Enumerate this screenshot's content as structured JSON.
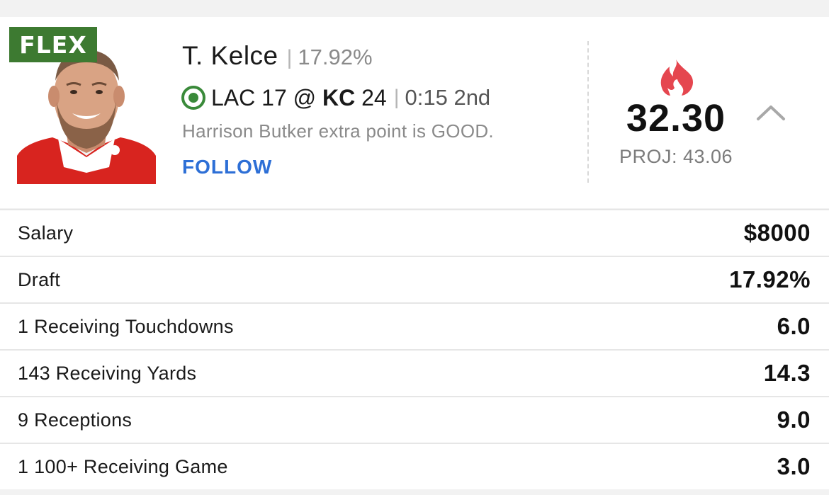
{
  "player": {
    "position": "FLEX",
    "name": "T. Kelce",
    "ownership": "17.92%",
    "follow_label": "FOLLOW"
  },
  "game": {
    "away": "LAC 17 @ ",
    "home_team": "KC",
    "home_score": " 24",
    "clock": "0:15 2nd",
    "last_play": "Harrison Butker extra point is GOOD."
  },
  "score": {
    "points": "32.30",
    "projection": "PROJ: 43.06"
  },
  "colors": {
    "position_badge": "#3d7a31",
    "live_indicator": "#3a8a3a",
    "follow_link": "#2d6fd6",
    "hot_flame": "#e5464f"
  },
  "icons": {
    "hot": "flame-icon",
    "collapse": "chevron-up-icon",
    "live": "live-game-icon"
  },
  "stats": [
    {
      "label": "Salary",
      "value": "$8000"
    },
    {
      "label": "Draft",
      "value": "17.92%"
    },
    {
      "label": "1 Receiving Touchdowns",
      "value": "6.0"
    },
    {
      "label": "143 Receiving Yards",
      "value": "14.3"
    },
    {
      "label": "9 Receptions",
      "value": "9.0"
    },
    {
      "label": "1 100+ Receiving Game",
      "value": "3.0"
    }
  ]
}
